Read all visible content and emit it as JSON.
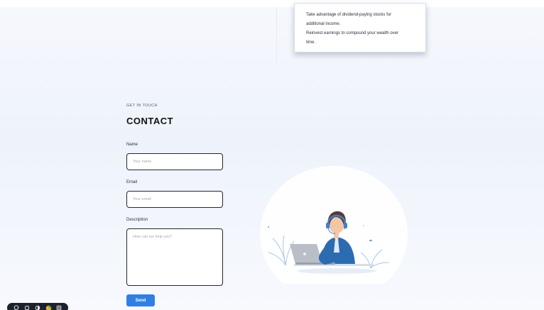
{
  "tips": {
    "lines": [
      "Take advantage of dividend-paying stocks for",
      "additional income.",
      "Reinvest earnings to compound your wealth over",
      "time."
    ]
  },
  "contact": {
    "eyebrow": "GET IN TOUCH",
    "title": "CONTACT",
    "name_label": "Name",
    "name_placeholder": "Your name",
    "email_label": "Email",
    "email_placeholder": "Your email",
    "description_label": "Description",
    "description_placeholder": "How can we help you?",
    "send_label": "Send"
  },
  "illustration": {
    "icon": "support-agent-laptop-illustration",
    "colors": {
      "accent": "#2f80e4",
      "jacket": "#2b6cb0",
      "headset": "#3b82d6",
      "laptop": "#b9bec7"
    }
  },
  "toolbar": {
    "icons": [
      "chat-bubble-icon",
      "copy-icon",
      "toggle-icon",
      "color-circle-icon",
      "grid-icon"
    ]
  },
  "colors": {
    "primary": "#2f80e4",
    "text": "#101318",
    "border": "#222630"
  }
}
